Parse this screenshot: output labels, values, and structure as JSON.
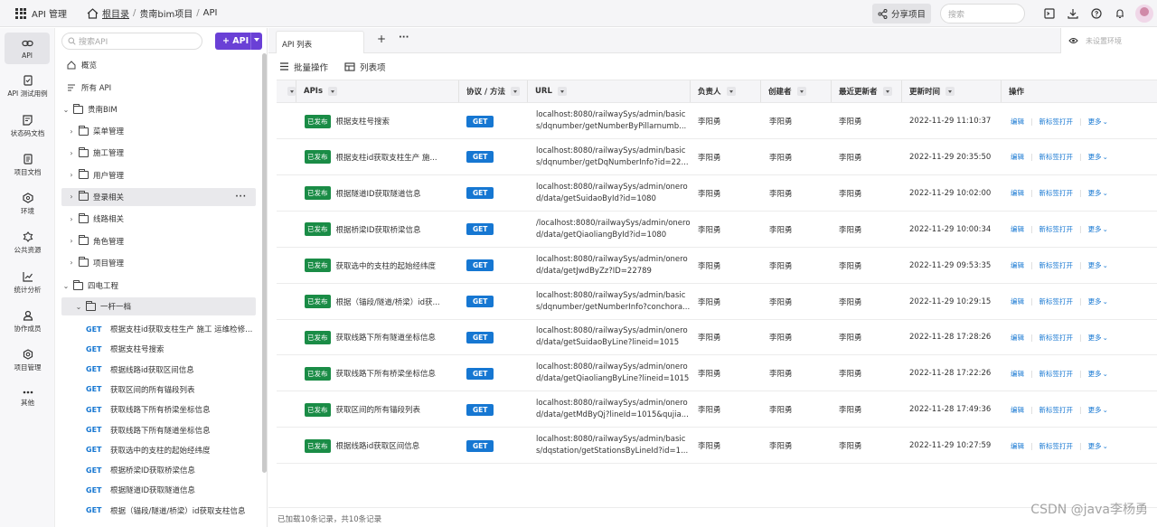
{
  "topbar": {
    "app_label": "API 管理",
    "breadcrumb": [
      "根目录",
      "/",
      "贵南bim项目",
      "/",
      "API"
    ],
    "share_label": "分享项目",
    "search_placeholder": "搜索"
  },
  "rail": [
    {
      "label": "API",
      "icon": "link-icon"
    },
    {
      "label": "API 测试用例",
      "icon": "test-case-icon"
    },
    {
      "label": "状态码文档",
      "icon": "status-doc-icon"
    },
    {
      "label": "项目文档",
      "icon": "project-doc-icon"
    },
    {
      "label": "环境",
      "icon": "environment-icon"
    },
    {
      "label": "公共资源",
      "icon": "public-resource-icon"
    },
    {
      "label": "统计分析",
      "icon": "chart-icon"
    },
    {
      "label": "协作成员",
      "icon": "members-icon"
    },
    {
      "label": "项目管理",
      "icon": "settings-icon"
    },
    {
      "label": "其他",
      "icon": "more-icon"
    }
  ],
  "tree": {
    "search_placeholder": "搜索API",
    "add_label": "+ API",
    "overview": "概览",
    "all_api": "所有 API",
    "root": "贵南BIM",
    "groups": [
      "菜单管理",
      "施工管理",
      "用户管理",
      "登录相关",
      "线路相关",
      "角色管理",
      "项目管理"
    ],
    "group_open": "四电工程",
    "subgroup": "一杆一档",
    "method": "GET",
    "apis": [
      "根据支柱id获取支柱生产 施工 运维检修...",
      "根据支柱号搜索",
      "根据线路id获取区间信息",
      "获取区间的所有锚段列表",
      "获取线路下所有桥梁坐标信息",
      "获取线路下所有隧道坐标信息",
      "获取选中的支柱的起始经纬度",
      "根据桥梁ID获取桥梁信息",
      "根据隧道ID获取隧道信息",
      "根据（锚段/隧道/桥梁）id获取支柱信息"
    ]
  },
  "tabs": {
    "active": "API 列表",
    "plus": "+",
    "more": "···",
    "env_label": "未设置环境"
  },
  "toolbar": {
    "batch_label": "批量操作",
    "columns_label": "列表项"
  },
  "table": {
    "headers": {
      "apis": "APIs",
      "protocol": "协议 / 方法",
      "url": "URL",
      "owner": "负责人",
      "creator": "创建者",
      "updater": "最近更新者",
      "updated": "更新时间",
      "ops": "操作"
    },
    "status_label": "已发布",
    "op_edit": "编辑",
    "op_newtab": "新标签打开",
    "op_more": "更多",
    "rows": [
      {
        "name": "根据支柱号搜索",
        "method": "GET",
        "url1": "localhost:8080/railwaySys/admin/basic",
        "url2": "s/dqnumber/getNumberByPillarnumb...",
        "owner": "李阳勇",
        "creator": "李阳勇",
        "updater": "李阳勇",
        "updated": "2022-11-29 11:10:37"
      },
      {
        "name": "根据支柱id获取支柱生产 施...",
        "method": "GET",
        "url1": "localhost:8080/railwaySys/admin/basic",
        "url2": "s/dqnumber/getDqNumberInfo?id=22...",
        "owner": "李阳勇",
        "creator": "李阳勇",
        "updater": "李阳勇",
        "updated": "2022-11-29 20:35:50"
      },
      {
        "name": "根据隧道ID获取隧道信息",
        "method": "GET",
        "url1": "localhost:8080/railwaySys/admin/onero",
        "url2": "d/data/getSuidaoById?id=1080",
        "owner": "李阳勇",
        "creator": "李阳勇",
        "updater": "李阳勇",
        "updated": "2022-11-29 10:02:00"
      },
      {
        "name": "根据桥梁ID获取桥梁信息",
        "method": "GET",
        "url1": "/localhost:8080/railwaySys/admin/onero",
        "url2": "d/data/getQiaoliangById?id=1080",
        "owner": "李阳勇",
        "creator": "李阳勇",
        "updater": "李阳勇",
        "updated": "2022-11-29 10:00:34"
      },
      {
        "name": "获取选中的支柱的起始经纬度",
        "method": "GET",
        "url1": "localhost:8080/railwaySys/admin/onero",
        "url2": "d/data/getJwdByZz?ID=22789",
        "owner": "李阳勇",
        "creator": "李阳勇",
        "updater": "李阳勇",
        "updated": "2022-11-29 09:53:35"
      },
      {
        "name": "根据（锚段/隧道/桥梁）id获...",
        "method": "GET",
        "url1": "localhost:8080/railwaySys/admin/basic",
        "url2": "s/dqnumber/getNumberInfo?conchora...",
        "owner": "李阳勇",
        "creator": "李阳勇",
        "updater": "李阳勇",
        "updated": "2022-11-29 10:29:15"
      },
      {
        "name": "获取线路下所有隧道坐标信息",
        "method": "GET",
        "url1": "localhost:8080/railwaySys/admin/onero",
        "url2": "d/data/getSuidaoByLine?lineid=1015",
        "owner": "李阳勇",
        "creator": "李阳勇",
        "updater": "李阳勇",
        "updated": "2022-11-28 17:28:26"
      },
      {
        "name": "获取线路下所有桥梁坐标信息",
        "method": "GET",
        "url1": "localhost:8080/railwaySys/admin/onero",
        "url2": "d/data/getQiaoliangByLine?lineid=1015",
        "owner": "李阳勇",
        "creator": "李阳勇",
        "updater": "李阳勇",
        "updated": "2022-11-28 17:22:26"
      },
      {
        "name": "获取区间的所有锚段列表",
        "method": "GET",
        "url1": "localhost:8080/railwaySys/admin/onero",
        "url2": "d/data/getMdByQj?lineId=1015&qujia...",
        "owner": "李阳勇",
        "creator": "李阳勇",
        "updater": "李阳勇",
        "updated": "2022-11-28 17:49:36"
      },
      {
        "name": "根据线路id获取区间信息",
        "method": "GET",
        "url1": "localhost:8080/railwaySys/admin/basic",
        "url2": "s/dqstation/getStationsByLineId?id=1...",
        "owner": "李阳勇",
        "creator": "李阳勇",
        "updater": "李阳勇",
        "updated": "2022-11-29 10:27:59"
      }
    ]
  },
  "footer": {
    "text": "已加载10条记录，共10条记录"
  },
  "watermark": "CSDN @java李杨勇",
  "colors": {
    "accent": "#6a40d6",
    "method_get": "#1677d2",
    "published": "#1a8c46"
  }
}
